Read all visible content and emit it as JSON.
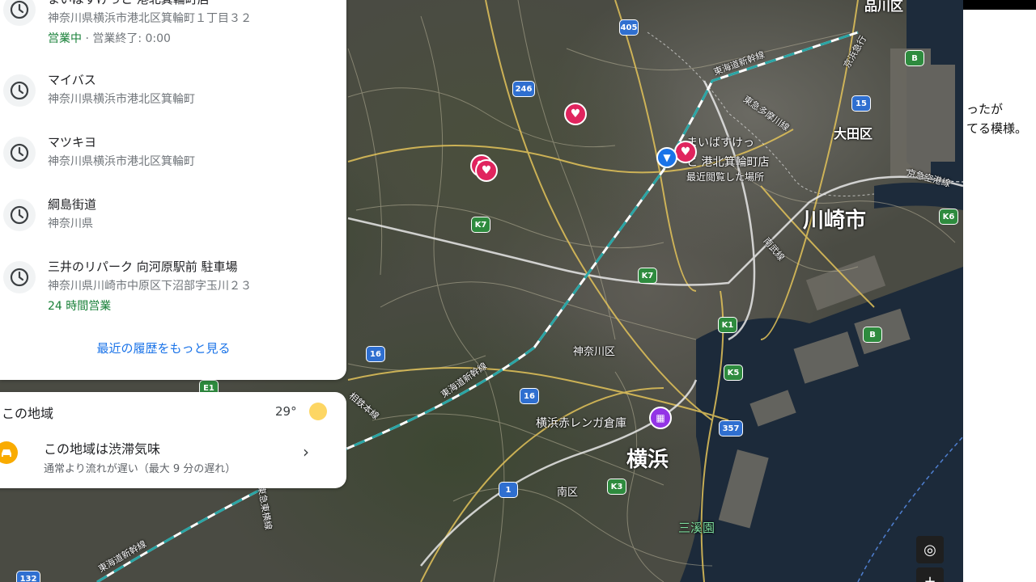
{
  "history": {
    "items": [
      {
        "title": "まいばすけっと 港北箕輪町店",
        "address": "神奈川県横浜市港北区箕輪町１丁目３２",
        "status_open": "営業中",
        "status_rest": " · 営業終了: 0:00"
      },
      {
        "title": "マイバス",
        "address": "神奈川県横浜市港北区箕輪町"
      },
      {
        "title": "マツキヨ",
        "address": "神奈川県横浜市港北区箕輪町"
      },
      {
        "title": "綱島街道",
        "address": "神奈川県"
      },
      {
        "title": "三井のリパーク 向河原駅前 駐車場",
        "address": "神奈川県川崎市中原区下沼部字玉川２３",
        "status_hours": "24 時間営業"
      }
    ],
    "more_link": "最近の履歴をもっと見る",
    "icon": "history-clock-icon"
  },
  "area": {
    "title": "この地域",
    "temperature": "29°",
    "weather_icon": "sun-icon",
    "traffic_title": "この地域は渋滞気味",
    "traffic_subtitle": "通常より流れが遅い（最大 9 分の遅れ）",
    "traffic_icon": "car-icon"
  },
  "map": {
    "labels": {
      "kawasaki": "川崎市",
      "yokohama": "横浜",
      "ota": "大田区",
      "kanagawa_ku": "神奈川区",
      "minami_ku": "南区",
      "shinagawa": "品川区",
      "sankeien": "三溪園",
      "red_brick": "横浜赤レンガ倉庫",
      "store_name_1": "まいばすけっ",
      "store_name_2": "と 港北箕輪町店",
      "recent_viewed": "最近閲覧した場所",
      "tokaido_1": "東海道新幹線",
      "tokaido_2": "東海道新幹線",
      "tokaido_3": "東海道新幹線",
      "tokyu_tamagawa": "東急多摩川線",
      "keihin_kyuko": "京浜急行",
      "nambu": "南武線",
      "sotetsu": "相鉄本線",
      "tokyu_toyoko": "東急東横線",
      "keikyu_kuko": "京急空港線",
      "keiyo": "京浜急"
    },
    "shields": {
      "r405": "405",
      "r246": "246",
      "k7a": "K7",
      "k7b": "K7",
      "r16a": "16",
      "r16b": "16",
      "k1": "K1",
      "k5": "K5",
      "r357": "357",
      "r1": "1",
      "k3": "K3",
      "r15": "15",
      "b1": "B",
      "b2": "B",
      "k6": "K6",
      "e1": "E1",
      "r132": "132"
    },
    "location_button_icon": "my-location-icon",
    "zoom_in_icon": "zoom-in-icon"
  },
  "right_pane": {
    "line1": "ったが",
    "line2": "てる模様。"
  },
  "colors": {
    "accent": "#1a73e8",
    "open_green": "#188038",
    "heart_pin": "#e0245e",
    "traffic_amber": "#f9ab00",
    "sun": "#fdd663"
  }
}
